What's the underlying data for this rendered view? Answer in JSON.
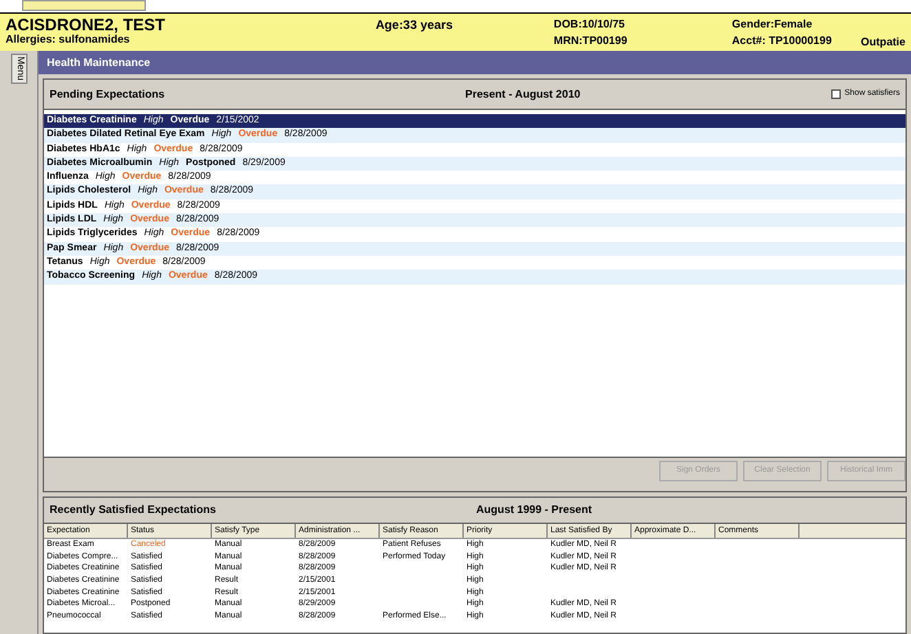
{
  "patient": {
    "name": "ACISDRONE2, TEST",
    "allergies": "Allergies: sulfonamides",
    "age": "Age:33 years",
    "dob": "DOB:10/10/75",
    "mrn": "MRN:TP00199",
    "gender": "Gender:Female",
    "acct": "Acct#: TP10000199",
    "visit": "Outpatie"
  },
  "side_tab": "Menu",
  "title_bar": "Health Maintenance",
  "pending": {
    "title": "Pending Expectations",
    "range": "Present - August 2010",
    "show_satisfiers": {
      "label": "Show satisfiers",
      "checked": false
    },
    "items": [
      {
        "name": "Diabetes Creatinine",
        "priority": "High",
        "status": "Overdue",
        "kind": "overdue",
        "date": "2/15/2002",
        "selected": true
      },
      {
        "name": "Diabetes Dilated Retinal Eye Exam",
        "priority": "High",
        "status": "Overdue",
        "kind": "overdue",
        "date": "8/28/2009",
        "selected": false
      },
      {
        "name": "Diabetes HbA1c",
        "priority": "High",
        "status": "Overdue",
        "kind": "overdue",
        "date": "8/28/2009",
        "selected": false
      },
      {
        "name": "Diabetes Microalbumin",
        "priority": "High",
        "status": "Postponed",
        "kind": "postponed",
        "date": "8/29/2009",
        "selected": false
      },
      {
        "name": "Influenza",
        "priority": "High",
        "status": "Overdue",
        "kind": "overdue",
        "date": "8/28/2009",
        "selected": false
      },
      {
        "name": "Lipids Cholesterol",
        "priority": "High",
        "status": "Overdue",
        "kind": "overdue",
        "date": "8/28/2009",
        "selected": false
      },
      {
        "name": "Lipids HDL",
        "priority": "High",
        "status": "Overdue",
        "kind": "overdue",
        "date": "8/28/2009",
        "selected": false
      },
      {
        "name": "Lipids LDL",
        "priority": "High",
        "status": "Overdue",
        "kind": "overdue",
        "date": "8/28/2009",
        "selected": false
      },
      {
        "name": "Lipids Triglycerides",
        "priority": "High",
        "status": "Overdue",
        "kind": "overdue",
        "date": "8/28/2009",
        "selected": false
      },
      {
        "name": "Pap Smear",
        "priority": "High",
        "status": "Overdue",
        "kind": "overdue",
        "date": "8/28/2009",
        "selected": false
      },
      {
        "name": "Tetanus",
        "priority": "High",
        "status": "Overdue",
        "kind": "overdue",
        "date": "8/28/2009",
        "selected": false
      },
      {
        "name": "Tobacco Screening",
        "priority": "High",
        "status": "Overdue",
        "kind": "overdue",
        "date": "8/28/2009",
        "selected": false
      }
    ]
  },
  "buttons": [
    {
      "label": "Sign Orders",
      "disabled": true
    },
    {
      "label": "Clear Selection",
      "disabled": true
    },
    {
      "label": "Historical Imm",
      "disabled": true
    }
  ],
  "recent": {
    "title": "Recently Satisfied Expectations",
    "range": "August 1999 - Present",
    "columns": [
      "Expectation",
      "Status",
      "Satisfy Type",
      "Administration ...",
      "Satisfy Reason",
      "Priority",
      "Last Satisfied By",
      "Approximate D...",
      "Comments"
    ],
    "rows": [
      {
        "kind": "canceled",
        "cells": [
          "Breast Exam",
          "Canceled",
          "Manual",
          "8/28/2009",
          "Patient Refuses",
          "High",
          "Kudler MD, Neil R",
          "",
          ""
        ]
      },
      {
        "kind": "normal",
        "cells": [
          "Diabetes Compre...",
          "Satisfied",
          "Manual",
          "8/28/2009",
          "Performed Today",
          "High",
          "Kudler MD, Neil R",
          "",
          ""
        ]
      },
      {
        "kind": "normal",
        "cells": [
          "Diabetes Creatinine",
          "Satisfied",
          "Manual",
          "8/28/2009",
          "",
          "High",
          "Kudler MD, Neil R",
          "",
          ""
        ]
      },
      {
        "kind": "normal",
        "cells": [
          "Diabetes Creatinine",
          "Satisfied",
          "Result",
          "2/15/2001",
          "",
          "High",
          "",
          "",
          ""
        ]
      },
      {
        "kind": "normal",
        "cells": [
          "Diabetes Creatinine",
          "Satisfied",
          "Result",
          "2/15/2001",
          "",
          "High",
          "",
          "",
          ""
        ]
      },
      {
        "kind": "normal",
        "cells": [
          "Diabetes Microal...",
          "Postponed",
          "Manual",
          "8/29/2009",
          "",
          "High",
          "Kudler MD, Neil R",
          "",
          ""
        ]
      },
      {
        "kind": "normal",
        "cells": [
          "Pneumococcal",
          "Satisfied",
          "Manual",
          "8/28/2009",
          "Performed Else...",
          "High",
          "Kudler MD, Neil R",
          "",
          ""
        ]
      }
    ]
  }
}
